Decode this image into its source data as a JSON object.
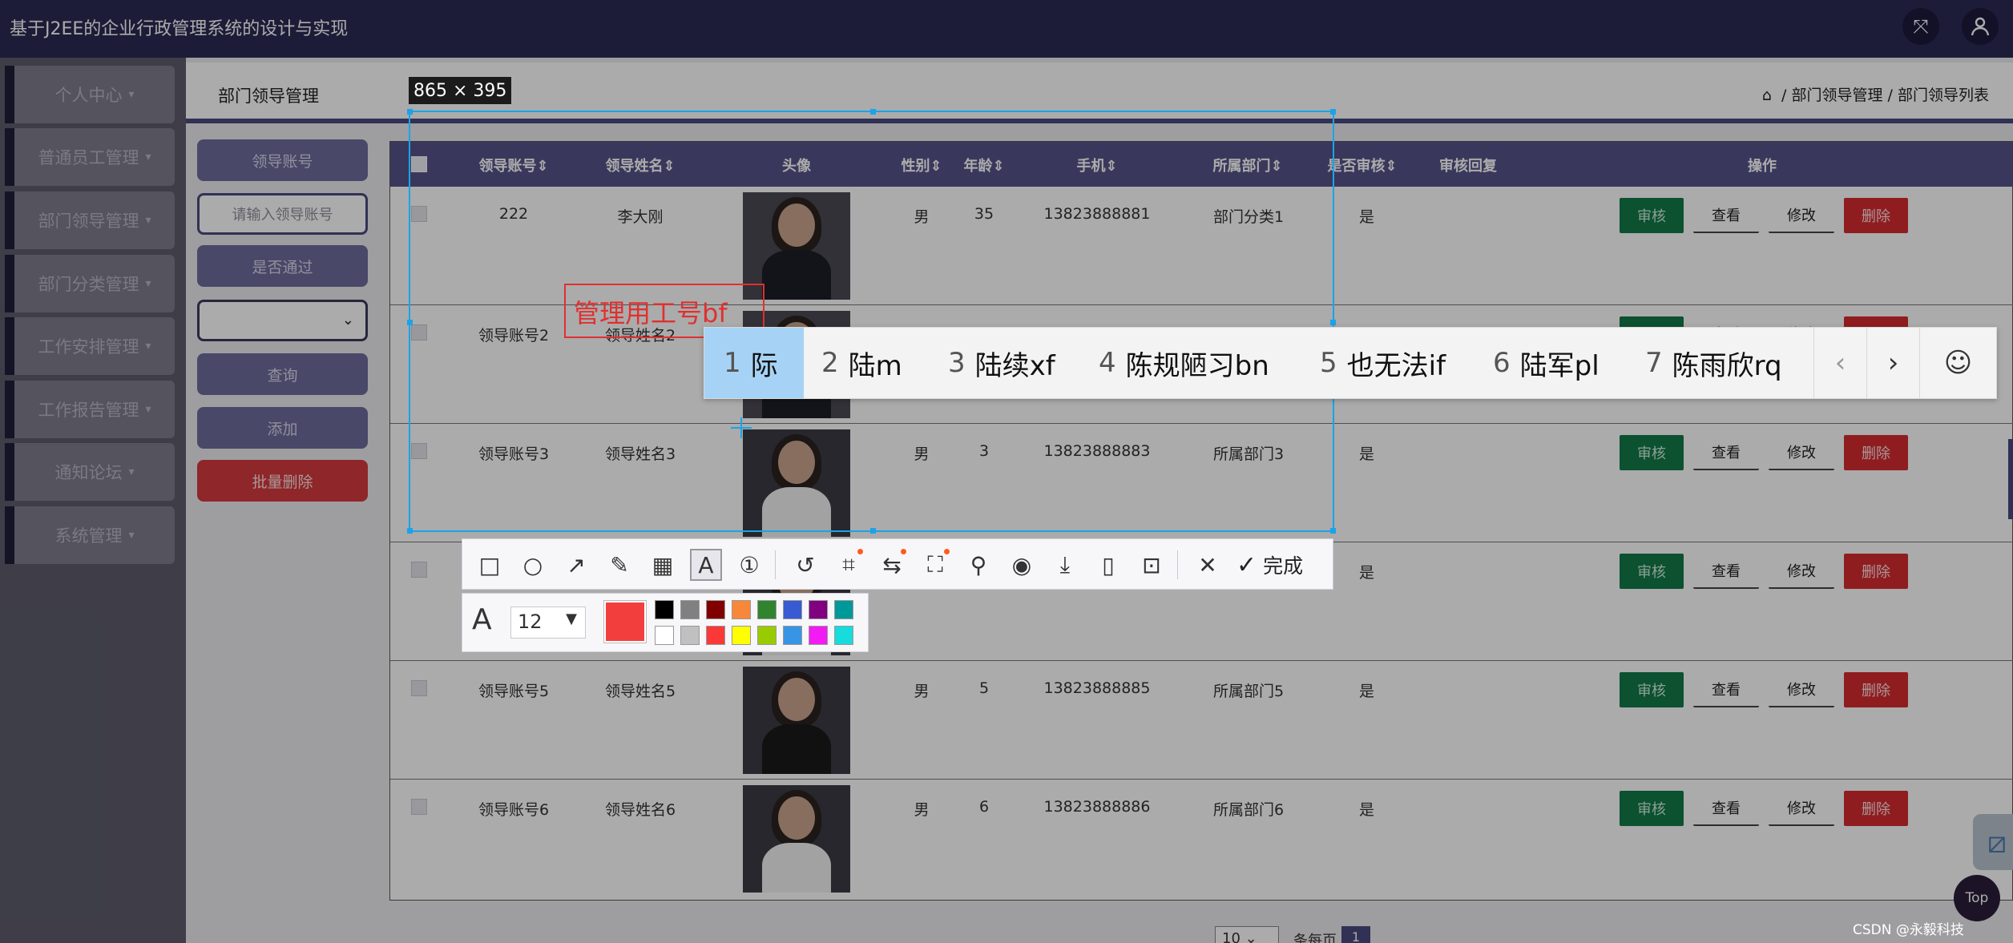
{
  "app_title": "基于J2EE的企业行政管理系统的设计与实现",
  "header_icons": [
    "fullscreen-icon",
    "user-icon"
  ],
  "sidebar": {
    "items": [
      {
        "label": "个人中心"
      },
      {
        "label": "普通员工管理"
      },
      {
        "label": "部门领导管理"
      },
      {
        "label": "部门分类管理"
      },
      {
        "label": "工作安排管理"
      },
      {
        "label": "工作报告管理"
      },
      {
        "label": "通知论坛"
      },
      {
        "label": "系统管理"
      }
    ]
  },
  "page": {
    "title": "部门领导管理",
    "breadcrumb": {
      "sep": "/",
      "level1": "部门领导管理",
      "level2": "部门领导列表"
    }
  },
  "filters": {
    "account_label": "领导账号",
    "account_placeholder": "请输入领导账号",
    "passed_label": "是否通过",
    "select_value": "",
    "query_button": "查询",
    "add_button": "添加",
    "batch_delete_button": "批量删除"
  },
  "table": {
    "columns": [
      "领导账号⇕",
      "领导姓名⇕",
      "头像",
      "性别⇕",
      "年龄⇕",
      "手机⇕",
      "所属部门⇕",
      "是否审核⇕",
      "审核回复",
      "操作"
    ],
    "actions": {
      "audit": "审核",
      "view": "查看",
      "edit": "修改",
      "delete": "删除"
    },
    "rows": [
      {
        "account": "222",
        "name": "李大刚",
        "gender": "男",
        "age": "35",
        "phone": "13823888881",
        "dept": "部门分类1",
        "audited": "是"
      },
      {
        "account": "领导账号2",
        "name": "领导姓名2",
        "gender": "",
        "age": "",
        "phone": "",
        "dept": "",
        "audited": ""
      },
      {
        "account": "领导账号3",
        "name": "领导姓名3",
        "gender": "男",
        "age": "3",
        "phone": "13823888883",
        "dept": "所属部门3",
        "audited": "是"
      },
      {
        "account": "",
        "name": "",
        "gender": "",
        "age": "",
        "phone": "",
        "dept": "",
        "audited": "是"
      },
      {
        "account": "领导账号5",
        "name": "领导姓名5",
        "gender": "男",
        "age": "5",
        "phone": "13823888885",
        "dept": "所属部门5",
        "audited": "是"
      },
      {
        "account": "领导账号6",
        "name": "领导姓名6",
        "gender": "男",
        "age": "6",
        "phone": "13823888886",
        "dept": "所属部门6",
        "audited": "是"
      }
    ]
  },
  "pagination": {
    "page_size": "10",
    "per_page_label": "条每页",
    "current_page": "1"
  },
  "snip": {
    "size_label": "865 × 395",
    "text_annotation": "管理用工号bf",
    "done_label": "完成",
    "font_size": "12",
    "current_color": "#f33e3e",
    "palette_top": [
      "#000000",
      "#808080",
      "#800000",
      "#f7883a",
      "#308430",
      "#385ad3",
      "#800080",
      "#009999"
    ],
    "palette_bottom": [
      "#ffffff",
      "#c0c0c0",
      "#fb3838",
      "#ffff00",
      "#99cc00",
      "#3894e4",
      "#f31bf3",
      "#16dcdc"
    ],
    "tools": [
      "rectangle-icon",
      "ellipse-icon",
      "arrow-icon",
      "pen-icon",
      "mosaic-icon",
      "text-icon",
      "number-icon",
      "undo-icon",
      "ocr-icon",
      "translate-icon",
      "scan-icon",
      "pin-icon",
      "record-icon",
      "download-icon",
      "long-screenshot-icon",
      "bookmark-icon",
      "close-icon"
    ]
  },
  "ime": {
    "candidates": [
      {
        "num": "1",
        "text": "际"
      },
      {
        "num": "2",
        "text": "陆m"
      },
      {
        "num": "3",
        "text": "陆续xf"
      },
      {
        "num": "4",
        "text": "陈规陋习bn"
      },
      {
        "num": "5",
        "text": "也无法if"
      },
      {
        "num": "6",
        "text": "陆军pl"
      },
      {
        "num": "7",
        "text": "陈雨欣rq"
      }
    ]
  },
  "top_button": "Top",
  "watermark": "CSDN @永毅科技"
}
